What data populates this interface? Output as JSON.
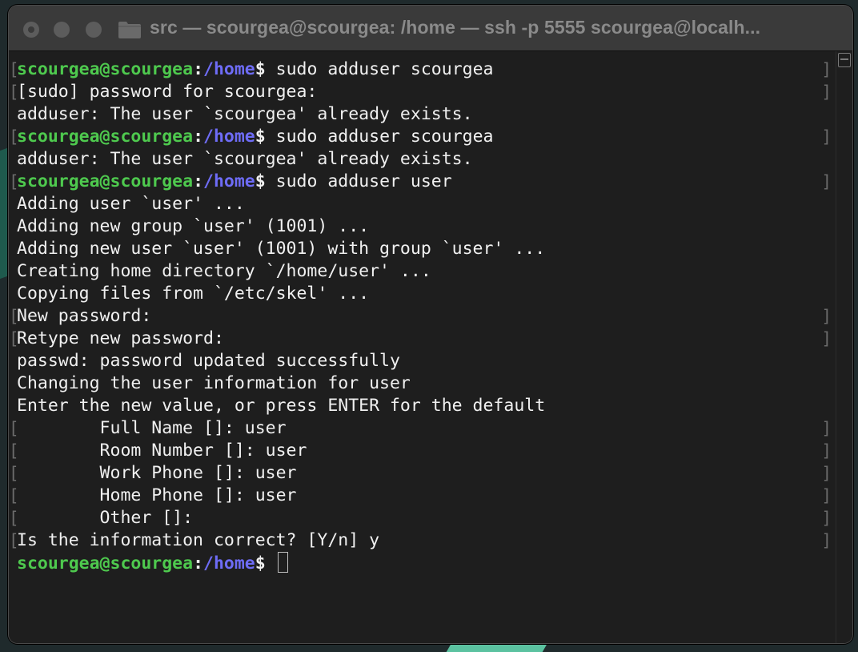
{
  "window": {
    "title": "src — scourgea@scourgea: /home — ssh -p 5555 scourgea@localh..."
  },
  "prompt": {
    "user": "scourgea@scourgea",
    "colon": ":",
    "path": "/home",
    "dollar": "$"
  },
  "terminal": {
    "lines": [
      {
        "kind": "cmd",
        "text": " sudo adduser scourgea",
        "marks": true
      },
      {
        "kind": "out",
        "text": "[sudo] password for scourgea:",
        "marks": true
      },
      {
        "kind": "out",
        "text": "adduser: The user `scourgea' already exists.",
        "marks": false
      },
      {
        "kind": "cmd",
        "text": " sudo adduser scourgea",
        "marks": true
      },
      {
        "kind": "out",
        "text": "adduser: The user `scourgea' already exists.",
        "marks": false
      },
      {
        "kind": "cmd",
        "text": " sudo adduser user",
        "marks": true
      },
      {
        "kind": "out",
        "text": "Adding user `user' ...",
        "marks": false
      },
      {
        "kind": "out",
        "text": "Adding new group `user' (1001) ...",
        "marks": false
      },
      {
        "kind": "out",
        "text": "Adding new user `user' (1001) with group `user' ...",
        "marks": false
      },
      {
        "kind": "out",
        "text": "Creating home directory `/home/user' ...",
        "marks": false
      },
      {
        "kind": "out",
        "text": "Copying files from `/etc/skel' ...",
        "marks": false
      },
      {
        "kind": "out",
        "text": "New password:",
        "marks": true
      },
      {
        "kind": "out",
        "text": "Retype new password:",
        "marks": true
      },
      {
        "kind": "out",
        "text": "passwd: password updated successfully",
        "marks": false
      },
      {
        "kind": "out",
        "text": "Changing the user information for user",
        "marks": false
      },
      {
        "kind": "out",
        "text": "Enter the new value, or press ENTER for the default",
        "marks": false
      },
      {
        "kind": "out",
        "text": "        Full Name []: user",
        "marks": true
      },
      {
        "kind": "out",
        "text": "        Room Number []: user",
        "marks": true
      },
      {
        "kind": "out",
        "text": "        Work Phone []: user",
        "marks": true
      },
      {
        "kind": "out",
        "text": "        Home Phone []: user",
        "marks": true
      },
      {
        "kind": "out",
        "text": "        Other []:",
        "marks": true
      },
      {
        "kind": "out",
        "text": "Is the information correct? [Y/n] y",
        "marks": true
      },
      {
        "kind": "prompt",
        "text": " ",
        "marks": false
      }
    ],
    "mark_left": "[",
    "mark_right": "]"
  },
  "icons": {
    "traffic_lights": [
      "close-icon",
      "minimize-icon",
      "maximize-icon"
    ],
    "folder": "folder-icon",
    "scrollbar": "scrollbar-toggle-icon"
  },
  "colors": {
    "user": "#4ec94e",
    "path": "#6e6cf6",
    "text": "#f0f0f0",
    "background": "#1e1e1e"
  }
}
